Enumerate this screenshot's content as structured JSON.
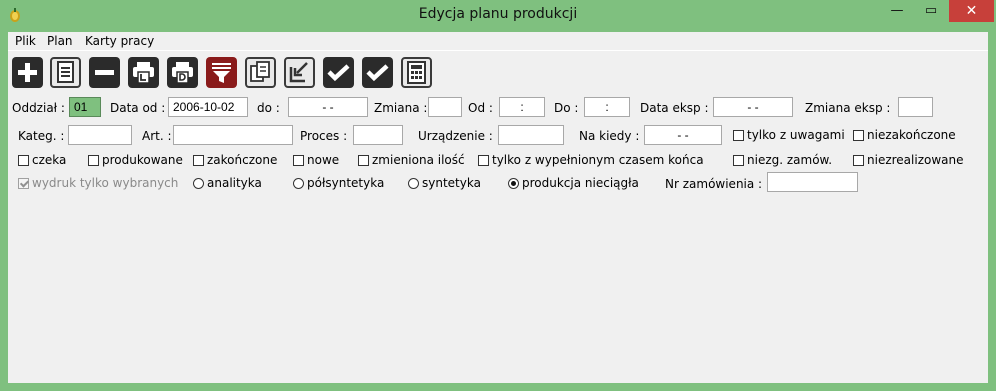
{
  "window": {
    "title": "Edycja planu produkcji",
    "minimize_glyph": "—",
    "maximize_glyph": "▭",
    "close_glyph": "✕",
    "accent_color": "#7fc07f"
  },
  "menu": {
    "plik": "Plik",
    "plan": "Plan",
    "karty": "Karty pracy"
  },
  "toolbar": [
    {
      "icon": "plus-icon"
    },
    {
      "icon": "document-icon"
    },
    {
      "icon": "minus-icon"
    },
    {
      "icon": "print-l-icon"
    },
    {
      "icon": "print-d-icon"
    },
    {
      "icon": "filter-icon"
    },
    {
      "icon": "copy-icon"
    },
    {
      "icon": "import-icon"
    },
    {
      "icon": "check-icon"
    },
    {
      "icon": "check-icon"
    },
    {
      "icon": "calculator-icon"
    }
  ],
  "filters": {
    "oddzial_label": "Oddział :",
    "oddzial_value": "01",
    "data_od_label": "Data od :",
    "data_od_value": "2006-10-02",
    "do_label": "do :",
    "do_value": "-  -",
    "zmiana_label": "Zmiana :",
    "zmiana_value": "",
    "od_label": "Od :",
    "od_value": ":",
    "do2_label": "Do :",
    "do2_value": ":",
    "data_eksp_label": "Data eksp :",
    "data_eksp_value": "-  -",
    "zmiana_eksp_label": "Zmiana eksp :",
    "zmiana_eksp_value": "",
    "kateg_label": "Kateg. :",
    "kateg_value": "",
    "art_label": "Art. :",
    "art_value": "",
    "proces_label": "Proces :",
    "proces_value": "",
    "urzadzenie_label": "Urządzenie :",
    "urzadzenie_value": "",
    "na_kiedy_label": "Na kiedy :",
    "na_kiedy_value": "-  -",
    "nr_zamowienia_label": "Nr zamówienia :",
    "nr_zamowienia_value": ""
  },
  "checkboxes": {
    "tylko_uwagi": "tylko z uwagami",
    "niezakonczone": "niezakończone",
    "czeka": "czeka",
    "produkowane": "produkowane",
    "zakonczone": "zakończone",
    "nowe": "nowe",
    "zmieniona_ilosc": "zmieniona ilość",
    "tylko_czas": "tylko z wypełnionym czasem końca",
    "niezg_zamow": "niezg. zamów.",
    "niezrealizowane": "niezrealizowane",
    "wydruk": "wydruk tylko wybranych"
  },
  "radios": {
    "analityka": "analityka",
    "polsyntetyka": "półsyntetyka",
    "syntetyka": "syntetyka",
    "produkcja": "produkcja nieciągła",
    "selected": "produkcja"
  }
}
